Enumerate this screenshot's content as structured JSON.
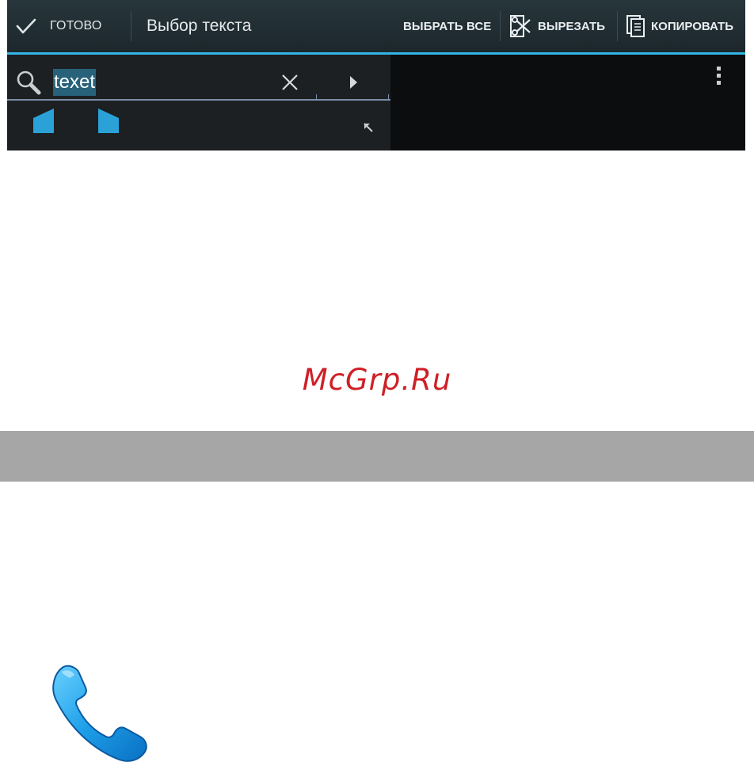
{
  "screenshot": {
    "action_bar": {
      "done_label": "ГОТОВО",
      "title": "Выбор текста",
      "select_all_label": "ВЫБРАТЬ ВСЕ",
      "cut_label": "ВЫРЕЗАТЬ",
      "copy_label": "КОПИРОВАТЬ",
      "accent_color": "#33b5e5"
    },
    "find_bar": {
      "query": "texet",
      "icons": [
        "search-icon",
        "clear-icon",
        "next-icon",
        "resize-icon",
        "overflow-menu-icon"
      ]
    }
  },
  "watermark": "McGrp.Ru",
  "footer_icon": "phone-icon"
}
